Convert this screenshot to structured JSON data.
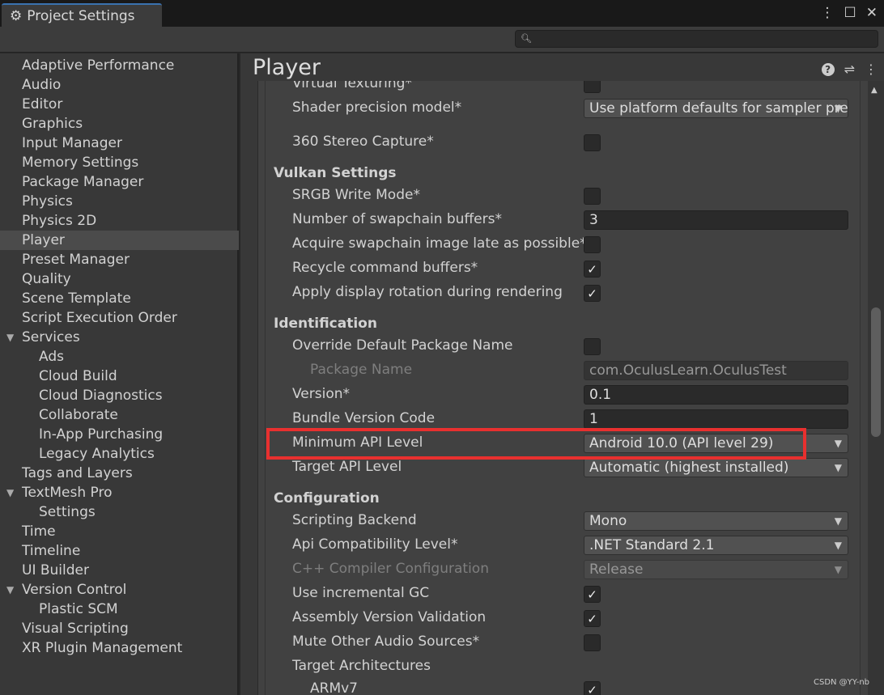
{
  "window": {
    "title": "Project Settings",
    "menu_icon": "⋮",
    "max_icon": "☐",
    "close_icon": "✕",
    "search_placeholder": ""
  },
  "sidebar": [
    {
      "label": "Adaptive Performance"
    },
    {
      "label": "Audio"
    },
    {
      "label": "Editor"
    },
    {
      "label": "Graphics"
    },
    {
      "label": "Input Manager"
    },
    {
      "label": "Memory Settings"
    },
    {
      "label": "Package Manager"
    },
    {
      "label": "Physics"
    },
    {
      "label": "Physics 2D"
    },
    {
      "label": "Player",
      "selected": true
    },
    {
      "label": "Preset Manager"
    },
    {
      "label": "Quality"
    },
    {
      "label": "Scene Template"
    },
    {
      "label": "Script Execution Order"
    },
    {
      "label": "Services",
      "expanded": true
    },
    {
      "label": "Ads",
      "indent": 1
    },
    {
      "label": "Cloud Build",
      "indent": 1
    },
    {
      "label": "Cloud Diagnostics",
      "indent": 1
    },
    {
      "label": "Collaborate",
      "indent": 1
    },
    {
      "label": "In-App Purchasing",
      "indent": 1
    },
    {
      "label": "Legacy Analytics",
      "indent": 1
    },
    {
      "label": "Tags and Layers"
    },
    {
      "label": "TextMesh Pro",
      "expanded": true
    },
    {
      "label": "Settings",
      "indent": 1
    },
    {
      "label": "Time"
    },
    {
      "label": "Timeline"
    },
    {
      "label": "UI Builder"
    },
    {
      "label": "Version Control",
      "expanded": true
    },
    {
      "label": "Plastic SCM",
      "indent": 1
    },
    {
      "label": "Visual Scripting"
    },
    {
      "label": "XR Plugin Management"
    }
  ],
  "main": {
    "title": "Player",
    "rows": [
      {
        "type": "checkbox",
        "label": "Virtual Texturing*",
        "checked": false
      },
      {
        "type": "dropdown",
        "label": "Shader precision model*",
        "value": "Use platform defaults for sampler precision"
      },
      {
        "type": "checkbox",
        "label": "360 Stereo Capture*",
        "checked": false
      },
      {
        "type": "header",
        "label": "Vulkan Settings"
      },
      {
        "type": "checkbox",
        "label": "SRGB Write Mode*",
        "checked": false
      },
      {
        "type": "text",
        "label": "Number of swapchain buffers*",
        "value": "3"
      },
      {
        "type": "checkbox",
        "label": "Acquire swapchain image late as possible*",
        "checked": false
      },
      {
        "type": "checkbox",
        "label": "Recycle command buffers*",
        "checked": true
      },
      {
        "type": "checkbox",
        "label": "Apply display rotation during rendering",
        "checked": true
      },
      {
        "type": "header",
        "label": "Identification"
      },
      {
        "type": "checkbox",
        "label": "Override Default Package Name",
        "checked": false
      },
      {
        "type": "text",
        "label": "Package Name",
        "value": "com.OculusLearn.OculusTest",
        "disabled": true,
        "indent": true
      },
      {
        "type": "text",
        "label": "Version*",
        "value": "0.1"
      },
      {
        "type": "text",
        "label": "Bundle Version Code",
        "value": "1"
      },
      {
        "type": "dropdown",
        "label": "Minimum API Level",
        "value": "Android 10.0 (API level 29)",
        "highlighted": true
      },
      {
        "type": "dropdown",
        "label": "Target API Level",
        "value": "Automatic (highest installed)"
      },
      {
        "type": "header",
        "label": "Configuration"
      },
      {
        "type": "dropdown",
        "label": "Scripting Backend",
        "value": "Mono"
      },
      {
        "type": "dropdown",
        "label": "Api Compatibility Level*",
        "value": ".NET Standard 2.1"
      },
      {
        "type": "dropdown",
        "label": "C++ Compiler Configuration",
        "value": "Release",
        "disabled": true
      },
      {
        "type": "checkbox",
        "label": "Use incremental GC",
        "checked": true
      },
      {
        "type": "checkbox",
        "label": "Assembly Version Validation",
        "checked": true
      },
      {
        "type": "checkbox",
        "label": "Mute Other Audio Sources*",
        "checked": false
      },
      {
        "type": "label",
        "label": "Target Architectures"
      },
      {
        "type": "checkbox",
        "label": "ARMv7",
        "checked": true,
        "indent": true
      }
    ]
  },
  "watermark": "CSDN @YY-nb",
  "colors": {
    "highlight": "#e8302f",
    "accent": "#3a72b0"
  }
}
